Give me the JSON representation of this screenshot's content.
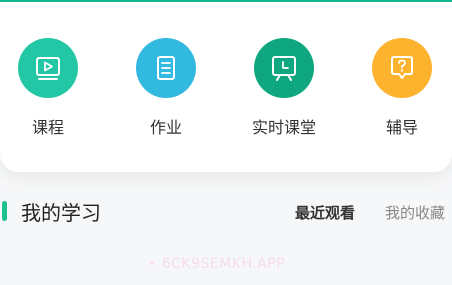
{
  "quick_actions": [
    {
      "label": "课程",
      "icon": "video-play-icon",
      "color": "#23c7a6"
    },
    {
      "label": "作业",
      "icon": "document-icon",
      "color": "#31b9e0"
    },
    {
      "label": "实时课堂",
      "icon": "live-clock-icon",
      "color": "#0fa780"
    },
    {
      "label": "辅导",
      "icon": "question-chat-icon",
      "color": "#fdb32d"
    }
  ],
  "my_learning": {
    "title": "我的学习",
    "tabs": [
      "最近观看",
      "我的收藏"
    ],
    "active_tab": "最近观看"
  },
  "watermark": "• 6CK9SEMKH.APP",
  "colors": {
    "accent": "#1bc28c"
  }
}
